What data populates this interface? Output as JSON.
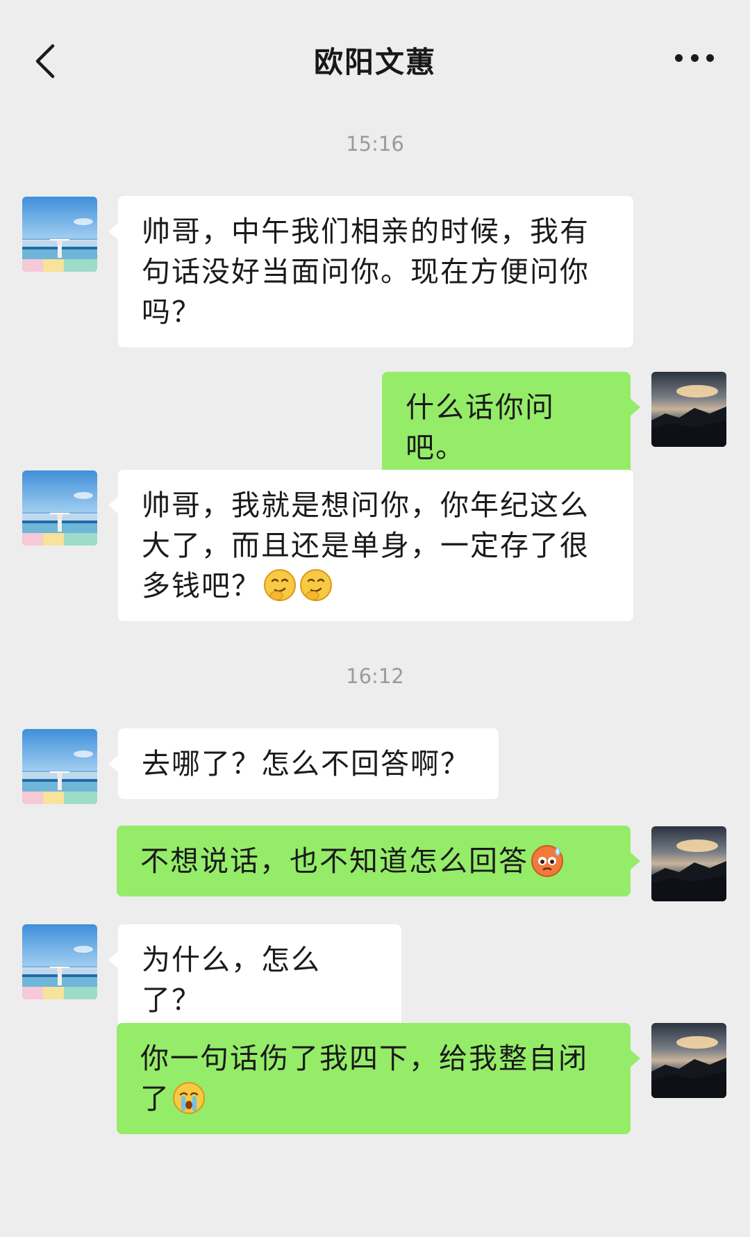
{
  "header": {
    "title": "欧阳文蕙",
    "back_icon": "chevron-left-icon",
    "more_icon": "more-dots-icon"
  },
  "messages": [
    {
      "type": "timestamp",
      "text": "15:16"
    },
    {
      "type": "message",
      "side": "left",
      "text": "帅哥，中午我们相亲的时候，我有句话没好当面问你。现在方便问你吗？"
    },
    {
      "type": "message",
      "side": "right",
      "text": "什么话你问吧。"
    },
    {
      "type": "message",
      "side": "left",
      "text": "帅哥，我就是想问你，你年纪这么大了，而且还是单身，一定存了很多钱吧？",
      "emojis": [
        "smirk-emoji",
        "smirk-emoji"
      ]
    },
    {
      "type": "timestamp",
      "text": "16:12"
    },
    {
      "type": "message",
      "side": "left",
      "text": "去哪了？怎么不回答啊？"
    },
    {
      "type": "message",
      "side": "right",
      "text": "不想说话，也不知道怎么回答",
      "emojis": [
        "sweat-emoji"
      ]
    },
    {
      "type": "message",
      "side": "left",
      "text": "为什么，怎么了？"
    },
    {
      "type": "message",
      "side": "right",
      "text": "你一句话伤了我四下，给我整自闭了",
      "emojis": [
        "crying-emoji"
      ]
    }
  ],
  "colors": {
    "background": "#ededed",
    "incoming_bubble": "#ffffff",
    "outgoing_bubble": "#95ec69",
    "timestamp_text": "#9a9a9a"
  }
}
